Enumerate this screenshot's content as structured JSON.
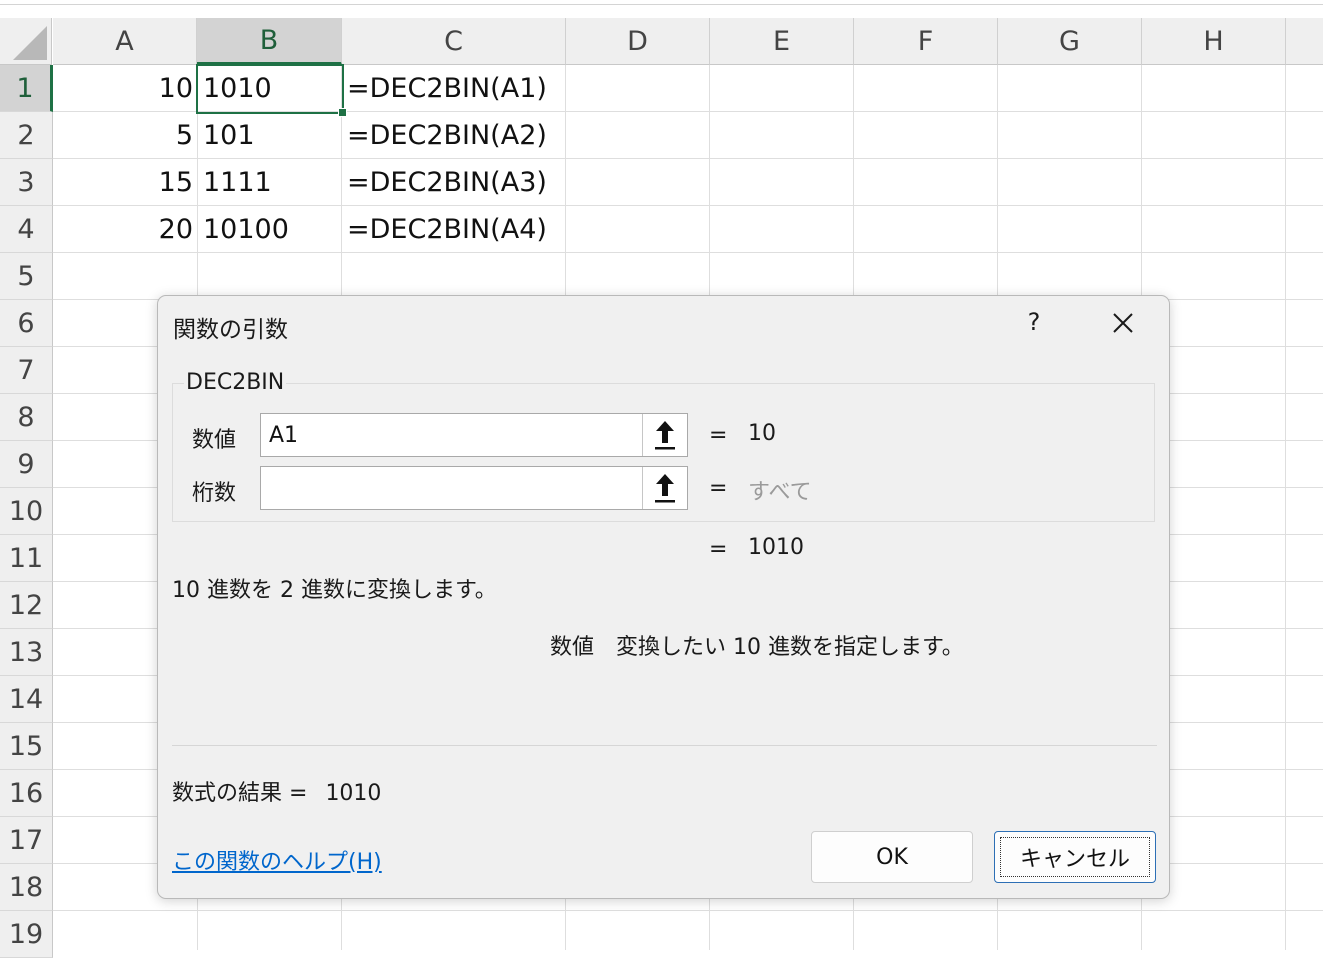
{
  "spreadsheet": {
    "columns": [
      "A",
      "B",
      "C",
      "D",
      "E",
      "F",
      "G",
      "H"
    ],
    "rows": [
      "1",
      "2",
      "3",
      "4",
      "5",
      "6",
      "7",
      "8",
      "9",
      "10",
      "11",
      "12",
      "13",
      "14",
      "15",
      "16",
      "17",
      "18",
      "19"
    ],
    "cells": [
      {
        "a": "10",
        "b": "1010",
        "c": "=DEC2BIN(A1)"
      },
      {
        "a": "5",
        "b": "101",
        "c": "=DEC2BIN(A2)"
      },
      {
        "a": "15",
        "b": "1111",
        "c": "=DEC2BIN(A3)"
      },
      {
        "a": "20",
        "b": "10100",
        "c": "=DEC2BIN(A4)"
      }
    ],
    "selected_column": "B",
    "selected_row": "1"
  },
  "dialog": {
    "title": "関数の引数",
    "help_button": "?",
    "function_name": "DEC2BIN",
    "args": [
      {
        "label": "数値",
        "value": "A1",
        "equals": "=",
        "result": "10"
      },
      {
        "label": "桁数",
        "value": "",
        "equals": "=",
        "result": "すべて"
      }
    ],
    "overall_equals": "=",
    "overall_result": "1010",
    "description": "10 進数を 2 進数に変換します。",
    "arg_desc_name": "数値",
    "arg_desc_text": "変換したい 10 進数を指定します。",
    "formula_result_label": "数式の結果 =",
    "formula_result_value": "1010",
    "help_link": "この関数のヘルプ(H)",
    "ok_label": "OK",
    "cancel_label": "キャンセル"
  },
  "colors": {
    "accent_green": "#1e7145",
    "link_blue": "#0066cc",
    "dialog_bg": "#f0f0f0"
  }
}
